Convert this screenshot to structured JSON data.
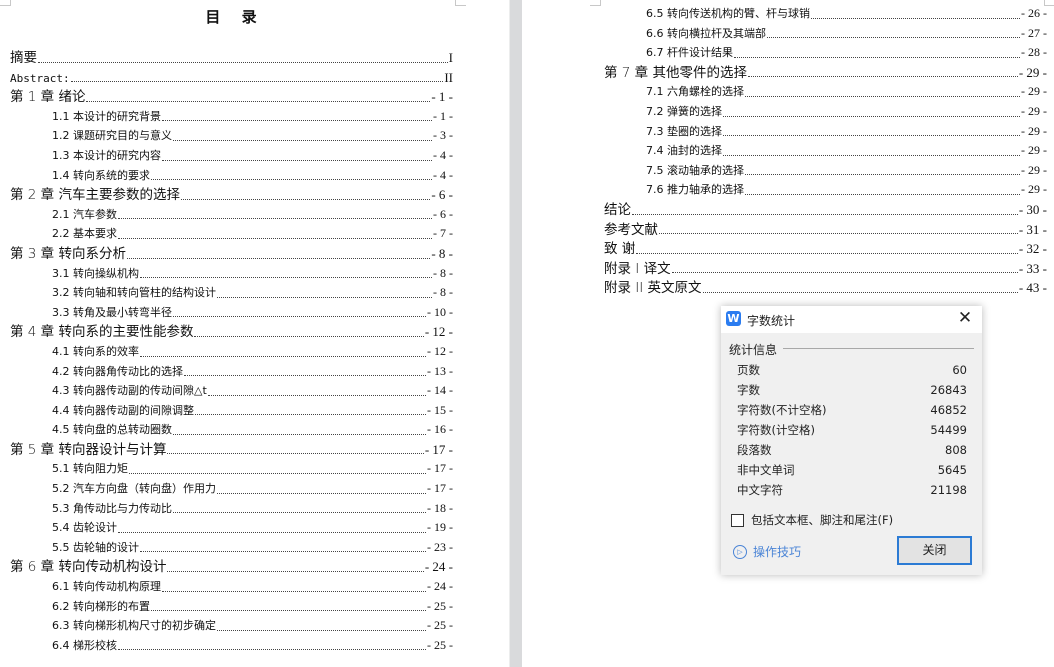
{
  "document": {
    "toc_title": "目 录",
    "left_page_entries": [
      {
        "label": "摘要",
        "page": "I",
        "level": 1
      },
      {
        "label": "Abstract:",
        "page": "II",
        "level": 1,
        "mono": true
      },
      {
        "label": "第 1 章  绪论",
        "page": "- 1 -",
        "level": 1
      },
      {
        "label": "1.1  本设计的研究背景",
        "page": "- 1 -",
        "level": 2
      },
      {
        "label": "1.2  课题研究目的与意义",
        "page": "- 3 -",
        "level": 2
      },
      {
        "label": "1.3  本设计的研究内容",
        "page": "- 4 -",
        "level": 2
      },
      {
        "label": "1.4  转向系统的要求",
        "page": "- 4 -",
        "level": 2
      },
      {
        "label": "第 2 章  汽车主要参数的选择",
        "page": "- 6 -",
        "level": 1
      },
      {
        "label": "2.1  汽车参数",
        "page": "- 6 -",
        "level": 2
      },
      {
        "label": "2.2  基本要求",
        "page": "- 7 -",
        "level": 2
      },
      {
        "label": "第 3 章  转向系分析",
        "page": "- 8 -",
        "level": 1
      },
      {
        "label": "3.1  转向操纵机构",
        "page": "- 8 -",
        "level": 2
      },
      {
        "label": "3.2  转向轴和转向管柱的结构设计",
        "page": "- 8 -",
        "level": 2
      },
      {
        "label": "3.3  转角及最小转弯半径",
        "page": "- 10 -",
        "level": 2
      },
      {
        "label": "第 4 章  转向系的主要性能参数",
        "page": "- 12 -",
        "level": 1
      },
      {
        "label": "4.1  转向系的效率",
        "page": "- 12 -",
        "level": 2
      },
      {
        "label": "4.2  转向器角传动比的选择",
        "page": "- 13 -",
        "level": 2
      },
      {
        "label": "4.3  转向器传动副的传动间隙△t",
        "page": "- 14 -",
        "level": 2
      },
      {
        "label": "4.4  转向器传动副的间隙调整",
        "page": "- 15 -",
        "level": 2
      },
      {
        "label": "4.5  转向盘的总转动圈数",
        "page": "- 16 -",
        "level": 2
      },
      {
        "label": "第 5 章  转向器设计与计算",
        "page": "- 17 -",
        "level": 1
      },
      {
        "label": "5.1  转向阻力矩",
        "page": "- 17 -",
        "level": 2
      },
      {
        "label": "5.2  汽车方向盘（转向盘）作用力",
        "page": "- 17 -",
        "level": 2
      },
      {
        "label": "5.3  角传动比与力传动比",
        "page": "- 18 -",
        "level": 2
      },
      {
        "label": "5.4  齿轮设计",
        "page": "- 19 -",
        "level": 2
      },
      {
        "label": "5.5  齿轮轴的设计",
        "page": "- 23 -",
        "level": 2
      },
      {
        "label": "第 6 章  转向传动机构设计",
        "page": "- 24 -",
        "level": 1
      },
      {
        "label": "6.1  转向传动机构原理",
        "page": "- 24 -",
        "level": 2
      },
      {
        "label": "6.2  转向梯形的布置",
        "page": "- 25 -",
        "level": 2
      },
      {
        "label": "6.3  转向梯形机构尺寸的初步确定",
        "page": "- 25 -",
        "level": 2
      },
      {
        "label": "6.4  梯形校核",
        "page": "- 25 -",
        "level": 2
      }
    ],
    "right_page_entries": [
      {
        "label": "6.5 转向传送机构的臂、杆与球销",
        "page": "- 26 -",
        "level": 2
      },
      {
        "label": "6.6 转向横拉杆及其端部",
        "page": "- 27 -",
        "level": 2
      },
      {
        "label": "6.7 杆件设计结果",
        "page": "- 28 -",
        "level": 2
      },
      {
        "label": "第 7 章    其他零件的选择",
        "page": "- 29 -",
        "level": 1
      },
      {
        "label": "7.1 六角螺栓的选择",
        "page": "- 29 -",
        "level": 2
      },
      {
        "label": "7.2 弹簧的选择",
        "page": "- 29 -",
        "level": 2
      },
      {
        "label": "7.3 垫圈的选择",
        "page": "- 29 -",
        "level": 2
      },
      {
        "label": "7.4 油封的选择",
        "page": "- 29 -",
        "level": 2
      },
      {
        "label": "7.5 滚动轴承的选择",
        "page": "- 29 -",
        "level": 2
      },
      {
        "label": "7.6 推力轴承的选择",
        "page": "- 29 -",
        "level": 2
      },
      {
        "label": "结论",
        "page": "- 30 -",
        "level": 1
      },
      {
        "label": "参考文献",
        "page": "- 31 -",
        "level": 1
      },
      {
        "label": "致    谢",
        "page": "- 32 -",
        "level": 1
      },
      {
        "label": "附录 I    译文",
        "page": "- 33 -",
        "level": 1
      },
      {
        "label": "附录 II    英文原文",
        "page": "- 43 -",
        "level": 1
      }
    ]
  },
  "dialog": {
    "app_icon": "W",
    "title": "字数统计",
    "close_icon": "✕",
    "group_title": "统计信息",
    "stats": [
      {
        "label": "页数",
        "value": "60"
      },
      {
        "label": "字数",
        "value": "26843"
      },
      {
        "label": "字符数(不计空格)",
        "value": "46852"
      },
      {
        "label": "字符数(计空格)",
        "value": "54499"
      },
      {
        "label": "段落数",
        "value": "808"
      },
      {
        "label": "非中文单词",
        "value": "5645"
      },
      {
        "label": "中文字符",
        "value": "21198"
      }
    ],
    "checkbox_label": "包括文本框、脚注和尾注(F)",
    "checkbox_checked": false,
    "tips_icon": "▷",
    "tips_label": "操作技巧",
    "close_button_label": "关闭",
    "colors": {
      "accent": "#2c7bd4",
      "link": "#4a84d6",
      "app_icon_bg": "#2b7cf0"
    }
  }
}
